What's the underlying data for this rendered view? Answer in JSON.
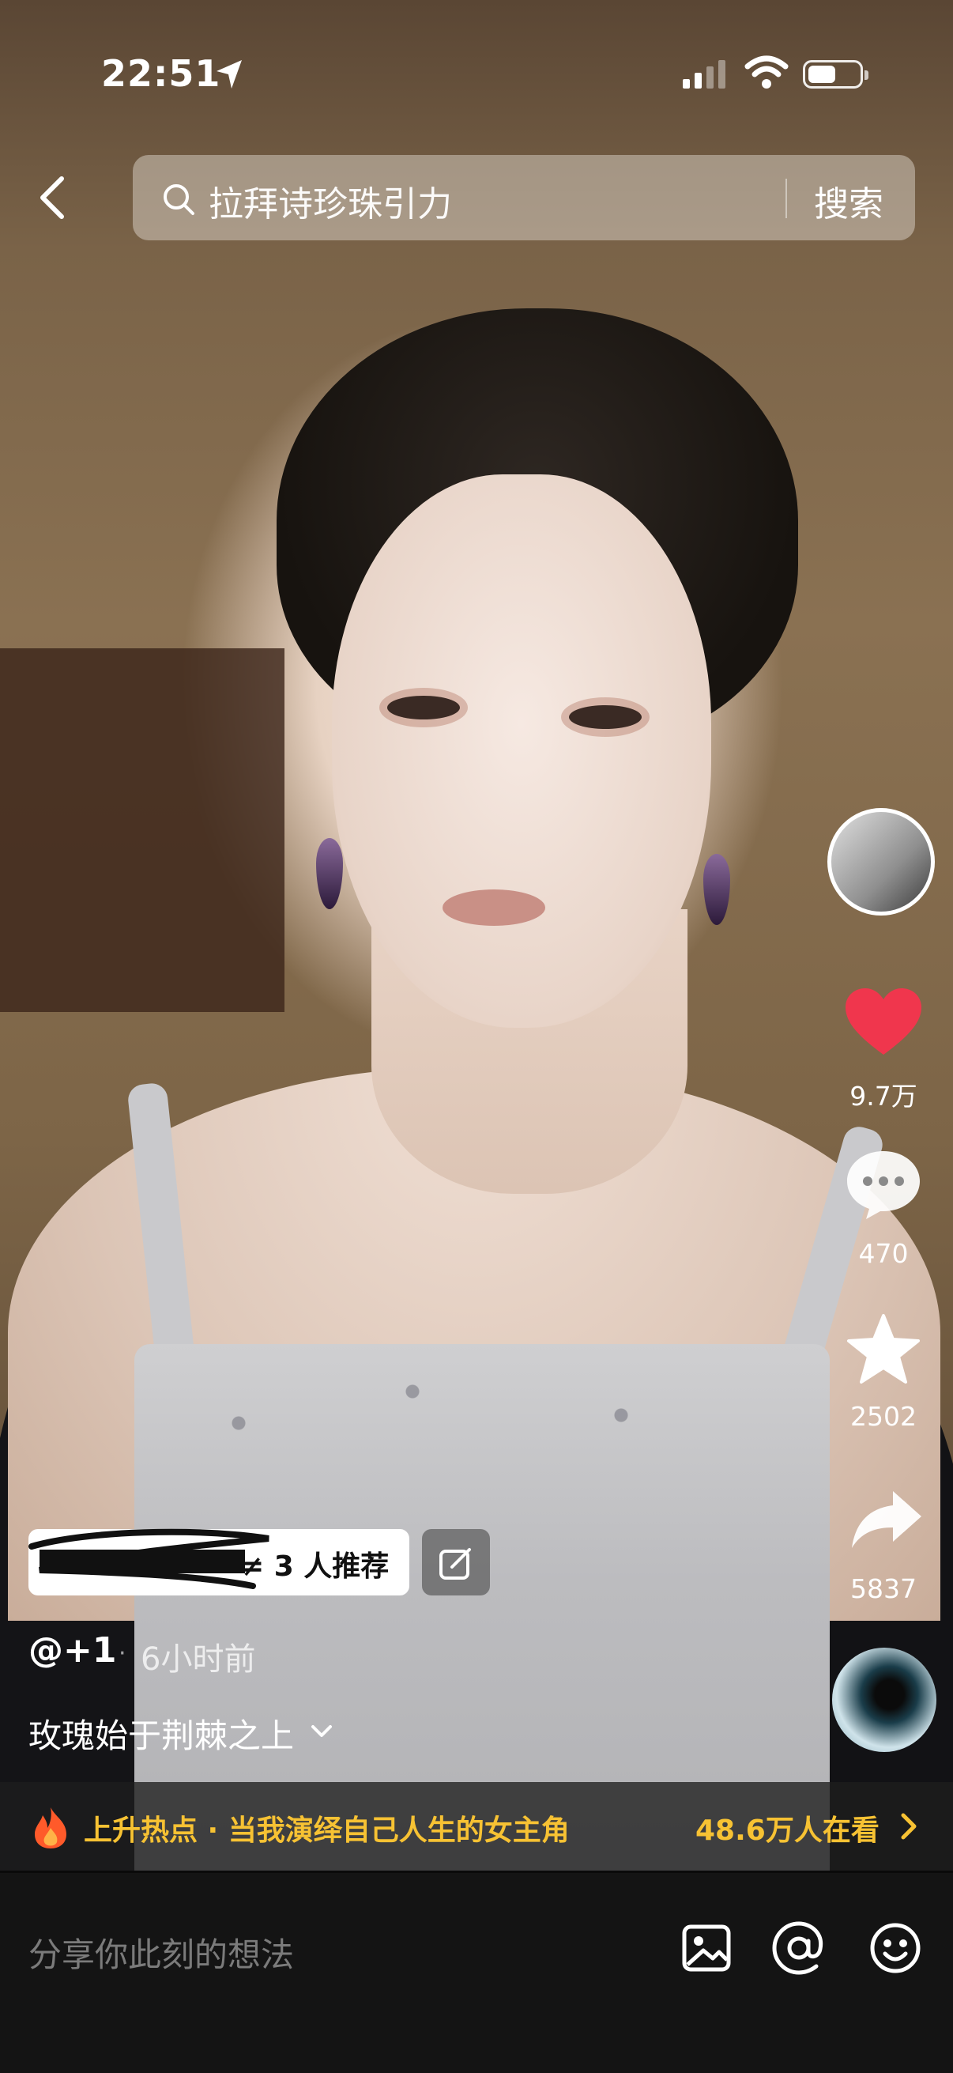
{
  "status": {
    "time": "22:51"
  },
  "search": {
    "query": "拉拜诗珍珠引力",
    "button": "搜索"
  },
  "rail": {
    "likes": "9.7万",
    "comments": "470",
    "favorites": "2502",
    "shares": "5837"
  },
  "post": {
    "recommend": "等 3 人推荐",
    "recommend_visible": "≠ 3 人推荐",
    "author": "@+1",
    "dot": "·",
    "time_ago": "6小时前",
    "caption": "玫瑰始于荆棘之上"
  },
  "hotbar": {
    "label": "上升热点 · 当我演绎自己人生的女主角",
    "viewers": "48.6万人在看"
  },
  "comment": {
    "placeholder": "分享你此刻的想法"
  },
  "colors": {
    "like": "#f0364d",
    "hot": "#f7c233"
  },
  "icons": [
    "location-arrow-icon",
    "search-icon",
    "back-chevron-icon",
    "heart-icon",
    "comment-bubble-icon",
    "star-icon",
    "share-arrow-icon",
    "edit-icon",
    "fire-icon",
    "chevron-right-icon",
    "image-icon",
    "at-icon",
    "emoji-icon"
  ]
}
